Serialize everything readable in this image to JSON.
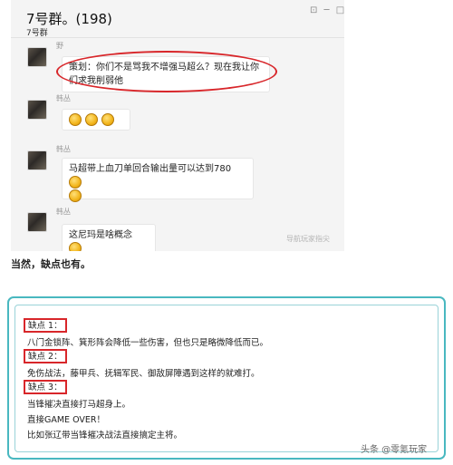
{
  "chat": {
    "title": "7号群。(198)",
    "subtitle": "7号群",
    "header_icons": "⊡ ─ □",
    "messages": [
      {
        "sender": "野",
        "text": "策划：你们不是骂我不增强马超么？现在我让你们求我削弱他"
      },
      {
        "sender": "韩丛",
        "emojis": 3
      },
      {
        "sender": "韩丛",
        "text": "马超带上血刀单回合输出量可以达到780"
      },
      {
        "sender": "韩丛",
        "text": "这尼玛是啥概念"
      }
    ],
    "watermark": "导航玩家指尖"
  },
  "caption": "当然，缺点也有。",
  "box": {
    "tag1": "缺点 1：",
    "line1": "八门金锁阵、箕形阵会降低一些伤害，但也只是略微降低而已。",
    "tag2": "缺点 2：",
    "line2": "免伤战法，藤甲兵、抚辑军民、御敌屏障遇到这样的就难打。",
    "tag3": "缺点 3：",
    "line3": "当锋摧决直接打马超身上。",
    "line4": "直接GAME OVER！",
    "line5": "比如张辽带当锋摧决战法直接搞定主将。"
  },
  "source": "头条 @零氪玩家",
  "colors": {
    "accent_teal": "#49b8c0",
    "highlight_red": "#d8262a",
    "chat_bg": "#f4f4f4"
  }
}
